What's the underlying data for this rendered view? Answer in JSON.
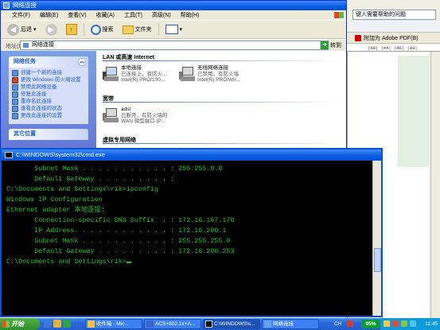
{
  "word": {
    "help_box": "键入需要帮助的问题",
    "adobe": "附加为 Adobe PDF(B)",
    "ruler": "|40|  |44|  |46|  |48|"
  },
  "explorer": {
    "title": "网络连接",
    "menu": [
      "文件(F)",
      "编辑(E)",
      "查看(V)",
      "收藏(A)",
      "工具(T)",
      "高级(N)",
      "帮助(H)"
    ],
    "toolbar": {
      "back": "后退",
      "search": "搜索",
      "folders": "文件夹"
    },
    "address": {
      "label": "地址(D)",
      "value": "网络连接",
      "go": "转到"
    },
    "taskpane": {
      "header": "网络任务",
      "items": [
        "创建一个新的连接",
        "更改 Windows 防火墙设置",
        "禁用此网络设备",
        "修复此连接",
        "重命名此连接",
        "查看此连接的状态",
        "更改此连接的设置"
      ],
      "other": "其它位置"
    },
    "groups": {
      "lan": "LAN 或高速 Internet",
      "broadband": "宽带",
      "vpn": "虚拟专用网络"
    },
    "connections": [
      {
        "name": "本地连接",
        "status": "已连接上，有防火...",
        "device": "Intel(R) PRO/100..."
      },
      {
        "name": "无线网络连接",
        "status": "已禁用，有防火墙",
        "device": "Intel(R) PRO/Wir..."
      },
      {
        "name": "adsl",
        "status": "已断开，有防火墙的",
        "device": "WAN 微型端口 (P..."
      }
    ]
  },
  "cmd": {
    "title": "C:\\WINDOWS\\system32\\cmd.exe",
    "lines": [
      "       Subnet Mask . . . . . . . . . . . : 255.255.0.0",
      "       Default Gateway . . . . . . . . . :",
      "",
      "C:\\Documents and Settings\\rik>ipconfig",
      "",
      "Windows IP Configuration",
      "",
      "",
      "Ethernet adapter 本地连接:",
      "",
      "       Connection-specific DNS Suffix  . : 172.16.167.170",
      "       IP Address. . . . . . . . . . . . : 172.16.200.1",
      "       Subnet Mask . . . . . . . . . . . : 255.255.255.0",
      "       Default Gateway . . . . . . . . . : 172.16.200.253",
      ""
    ],
    "prompt": "C:\\Documents and Settings\\rik>"
  },
  "taskbar": {
    "start": "开始",
    "tasks": [
      {
        "label": "收件箱 - Mic..."
      },
      {
        "label": "ACS+802.1x+A..."
      },
      {
        "label": "C:\\WINDOWS\\s..."
      },
      {
        "label": "网络连接"
      }
    ],
    "tray": {
      "lang": "CH",
      "battery": "95%",
      "time": "11:45"
    }
  }
}
